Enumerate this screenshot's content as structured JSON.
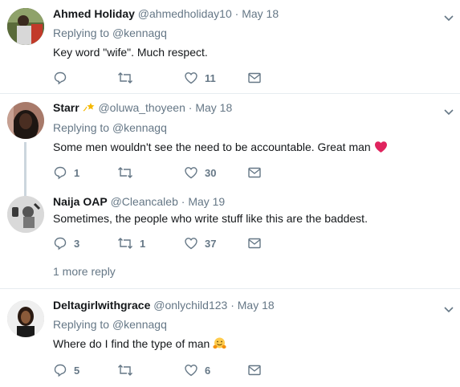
{
  "reply_prefix": "Replying to",
  "replies": [
    {
      "name": "Ahmed Holiday",
      "handle": "@ahmedholiday10",
      "date": "May 18",
      "replying_to": "@kennagq",
      "text": "Key word \"wife\". Much respect.",
      "counts": {
        "reply": "",
        "retweet": "",
        "like": "11"
      }
    },
    {
      "name": "Starr",
      "handle": "@oluwa_thoyeen",
      "date": "May 18",
      "replying_to": "@kennagq",
      "text": "Some men wouldn't see the need to be accountable. Great man",
      "emoji": "heart",
      "counts": {
        "reply": "1",
        "retweet": "",
        "like": "30"
      }
    },
    {
      "name": "Naija OAP",
      "handle": "@Cleancaleb",
      "date": "May 19",
      "text": "Sometimes, the people who write stuff like this are the baddest.",
      "counts": {
        "reply": "3",
        "retweet": "1",
        "like": "37"
      }
    },
    {
      "name": "Deltagirlwithgrace",
      "handle": "@onlychild123",
      "date": "May 18",
      "replying_to": "@kennagq",
      "text": "Where do I find the type of man",
      "emoji": "hugging-face",
      "counts": {
        "reply": "5",
        "retweet": "",
        "like": "6"
      }
    }
  ],
  "more_replies": "1 more reply",
  "icons": [
    "reply-icon",
    "retweet-icon",
    "like-icon",
    "message-icon",
    "chevron-down-icon"
  ],
  "colors": {
    "text": "#14171a",
    "muted": "#657786",
    "thread_line": "#ccd6dd",
    "divider": "#e6ecf0",
    "heart": "#e0245e"
  }
}
